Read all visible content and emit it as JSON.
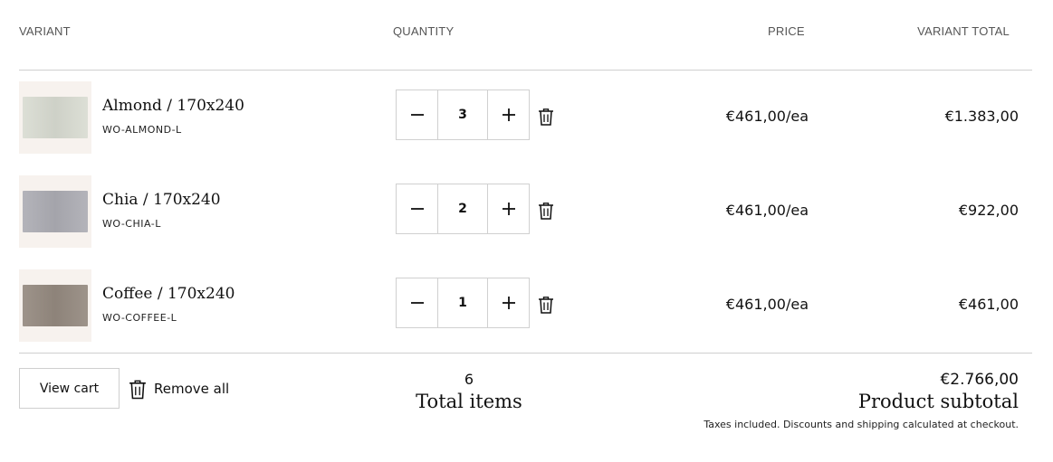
{
  "columns": {
    "variant": "VARIANT",
    "quantity": "QUANTITY",
    "price": "PRICE",
    "variant_total": "VARIANT TOTAL"
  },
  "items": [
    {
      "name": "Almond / 170x240",
      "sku": "WO-ALMOND-L",
      "quantity": "3",
      "price": "€461,00/ea",
      "total": "€1.383,00",
      "swatch_color": "#d9dcd2"
    },
    {
      "name": "Chia / 170x240",
      "sku": "WO-CHIA-L",
      "quantity": "2",
      "price": "€461,00/ea",
      "total": "€922,00",
      "swatch_color": "#adadb4"
    },
    {
      "name": "Coffee / 170x240",
      "sku": "WO-COFFEE-L",
      "quantity": "1",
      "price": "€461,00/ea",
      "total": "€461,00",
      "swatch_color": "#958a80"
    }
  ],
  "footer": {
    "view_cart": "View cart",
    "remove_all": "Remove all",
    "total_items_count": "6",
    "total_items_label": "Total items",
    "subtotal_value": "€2.766,00",
    "subtotal_label": "Product subtotal",
    "tax_note": "Taxes included. Discounts and shipping calculated at checkout."
  },
  "icons": {
    "decrease": "minus-icon",
    "increase": "plus-icon",
    "remove": "trash-icon"
  }
}
